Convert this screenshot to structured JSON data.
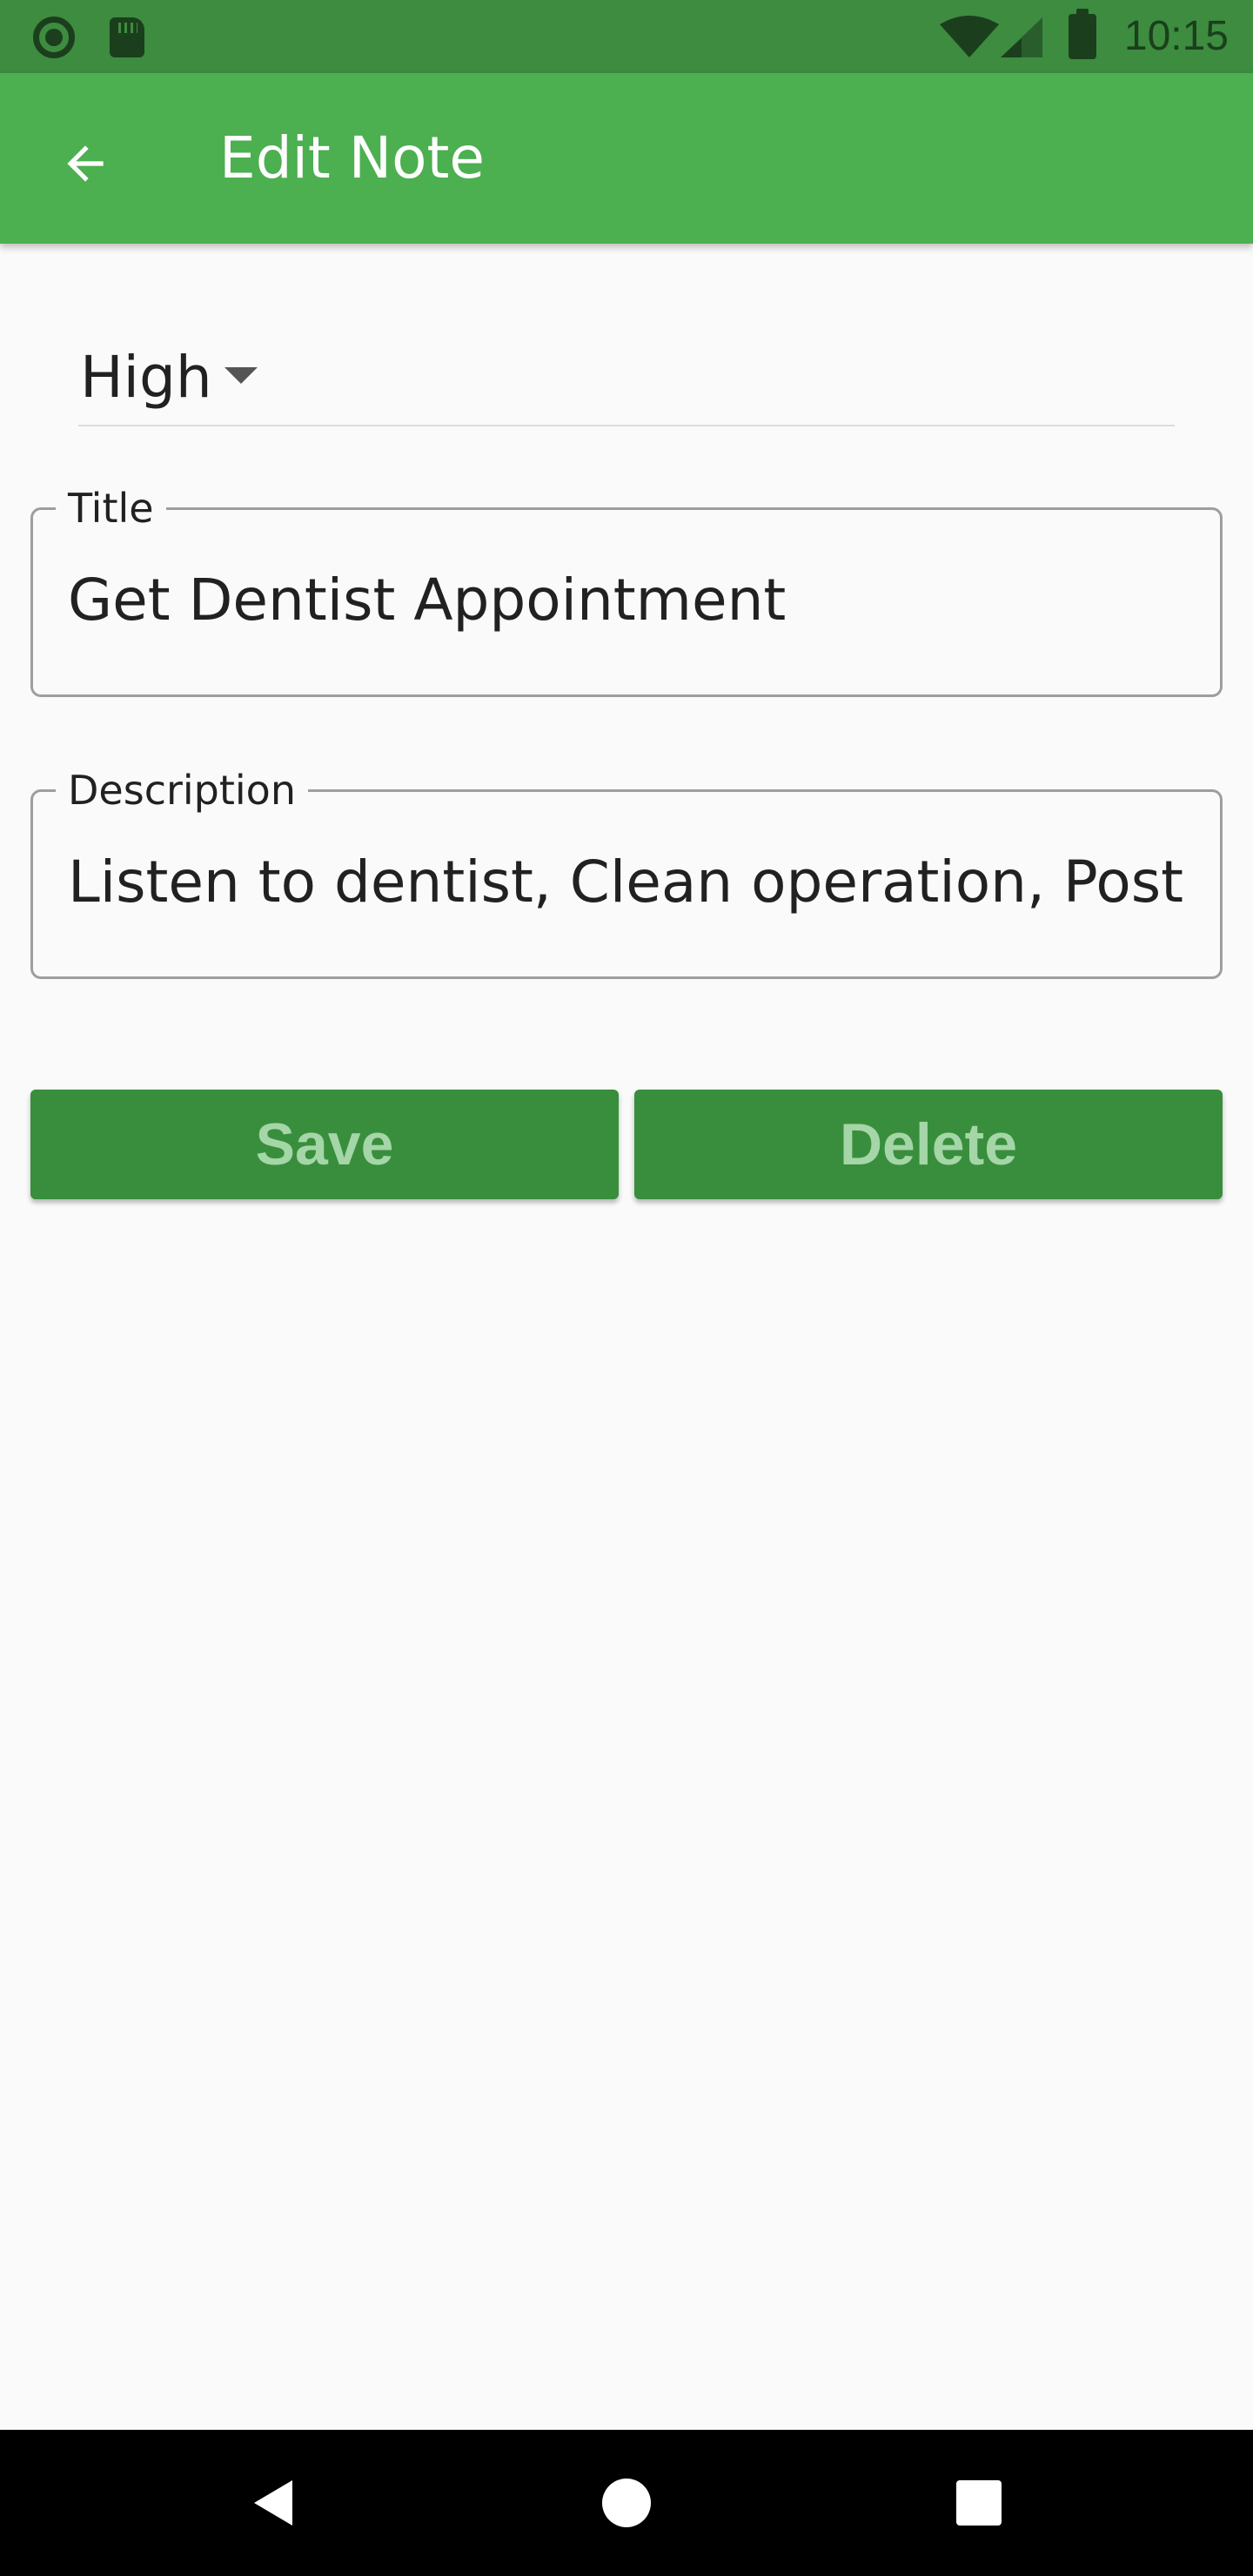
{
  "status_bar": {
    "time": "10:15",
    "icons": [
      "circle-notification-icon",
      "sd-card-icon",
      "wifi-icon",
      "cell-signal-icon",
      "battery-icon"
    ]
  },
  "app_bar": {
    "title": "Edit Note",
    "back_icon": "arrow-back-icon",
    "background_color": "#4caf50"
  },
  "priority": {
    "selected": "High",
    "icon": "dropdown-caret-icon"
  },
  "title_field": {
    "label": "Title",
    "value": "Get Dentist Appointment"
  },
  "description_field": {
    "label": "Description",
    "value": "Listen to dentist, Clean operation, Post X-"
  },
  "buttons": {
    "save_label": "Save",
    "delete_label": "Delete",
    "color": "#388e3c",
    "text_color": "#a5d6a7"
  },
  "nav_bar": {
    "icons": [
      "nav-back-icon",
      "nav-home-icon",
      "nav-recents-icon"
    ]
  }
}
